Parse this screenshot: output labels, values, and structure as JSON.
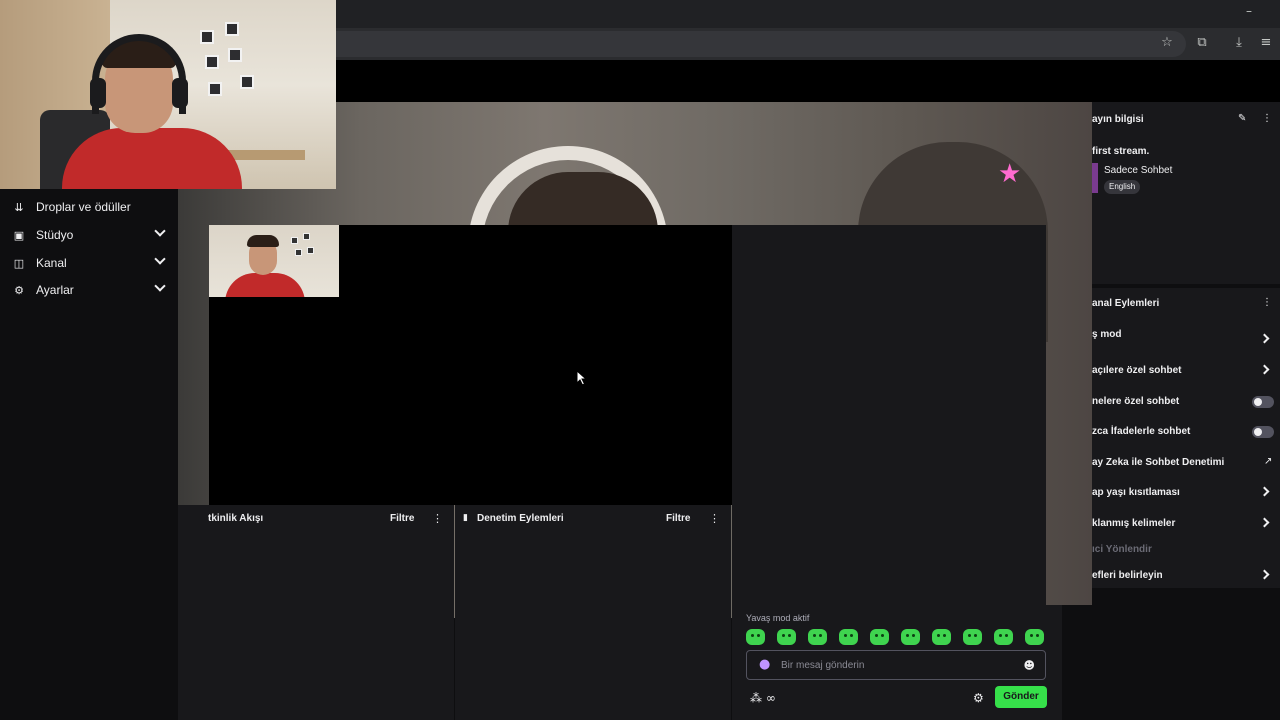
{
  "sidebar": {
    "items": [
      {
        "label": "Droplar ve ödüller",
        "icon": "drops-icon",
        "expandable": false
      },
      {
        "label": "Stüdyo",
        "icon": "studio-icon",
        "expandable": true
      },
      {
        "label": "Kanal",
        "icon": "channel-icon",
        "expandable": true
      },
      {
        "label": "Ayarlar",
        "icon": "gear-icon",
        "expandable": true
      }
    ]
  },
  "panels": {
    "activity": {
      "title": "tkinlik Akışı",
      "filter": "Filtre"
    },
    "moderation": {
      "title": "Denetim Eylemleri",
      "filter": "Filtre"
    }
  },
  "chat": {
    "slow_mode": "Yavaş mod aktif",
    "placeholder": "Bir mesaj gönderin",
    "send_label": "Gönder",
    "points": "∞"
  },
  "stream_info": {
    "title": "ayın bilgisi",
    "stream_title": "first stream.",
    "category": "Sadece Sohbet",
    "language": "English"
  },
  "channel_actions": {
    "title": "anal Eylemleri",
    "rows": [
      {
        "label": "ş mod",
        "control": "chevron"
      },
      {
        "label": "açılere özel sohbet",
        "control": "chevron"
      },
      {
        "label": "nelere özel sohbet",
        "control": "toggle",
        "on": false
      },
      {
        "label": "zca İfadelerle sohbet",
        "control": "toggle",
        "on": false
      },
      {
        "label": "ay Zeka ile Sohbet Denetimi",
        "control": "external"
      },
      {
        "label": "ap yaşı kısıtlaması",
        "control": "chevron"
      },
      {
        "label": "klanmış kelimeler",
        "control": "chevron"
      },
      {
        "label": "ıci Yönlendir",
        "control": "section"
      },
      {
        "label": "efleri belirleyin",
        "control": "chevron"
      }
    ]
  },
  "colors": {
    "accent_green": "#36e04a",
    "background": "#0e0e10",
    "panel": "#18181b"
  }
}
